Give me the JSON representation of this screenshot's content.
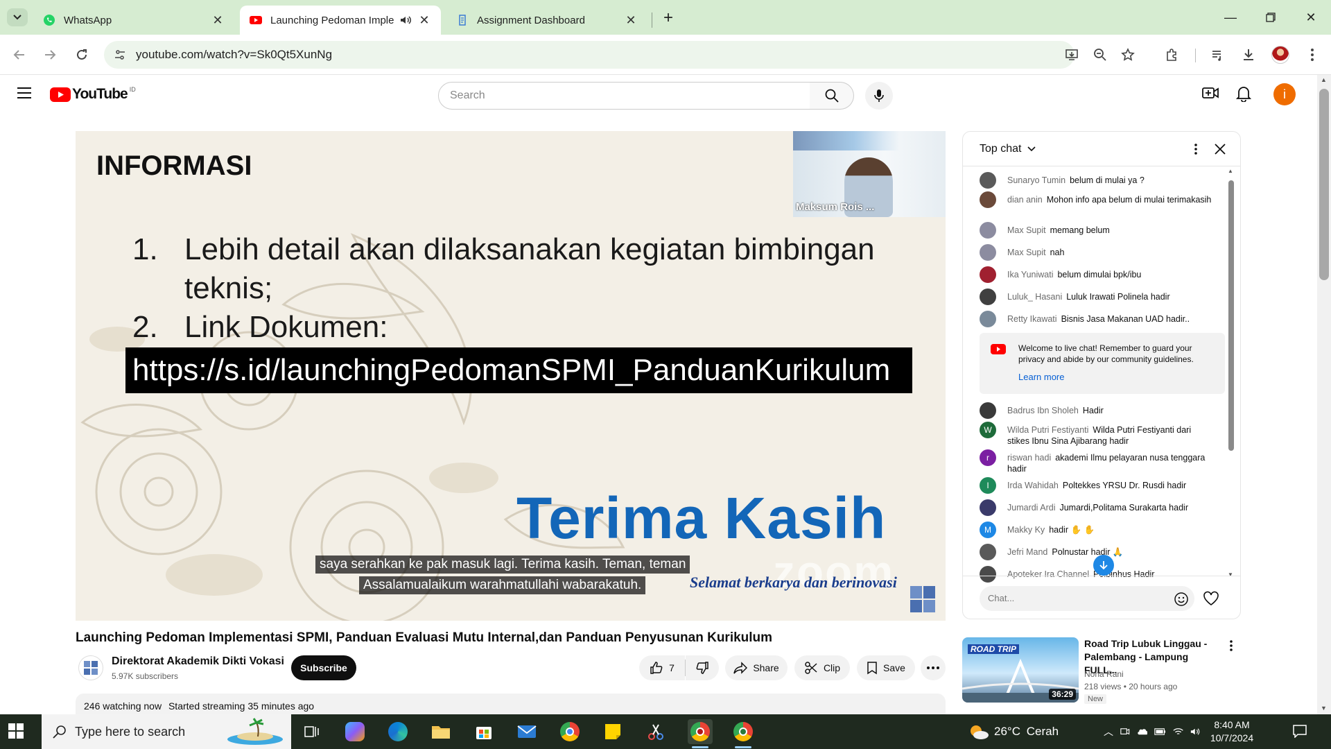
{
  "tabs": [
    {
      "label": "WhatsApp",
      "icon": "whatsapp-icon"
    },
    {
      "label": "Launching Pedoman Implem",
      "icon": "youtube-icon",
      "active": true
    },
    {
      "label": "Assignment Dashboard",
      "icon": "assignment-icon"
    }
  ],
  "address": {
    "url": "youtube.com/watch?v=Sk0Qt5XunNg"
  },
  "youtube": {
    "logo_text": "YouTube",
    "region": "ID",
    "search_placeholder": "Search",
    "avatar_letter": "i"
  },
  "video": {
    "slide_heading": "INFORMASI",
    "item1_num": "1.",
    "item1_text": "Lebih detail akan dilaksanakan kegiatan bimbingan",
    "item1_cont": "teknis;",
    "item2_num": "2.",
    "item2_text": "Link Dokumen:",
    "link": "https://s.id/launchingPedomanSPMI_PanduanKurikulum",
    "thanks": "Terima Kasih",
    "tagline": "Selamat berkarya dan berinovasi",
    "watermark": "zoom",
    "caption1": "saya serahkan ke pak masuk lagi. Terima kasih. Teman, teman",
    "caption2": "Assalamualaikum warahmatullahi wabarakatuh.",
    "pip_name": "Maksum Rois ...",
    "title": "Launching Pedoman Implementasi SPMI, Panduan Evaluasi Mutu Internal,dan Panduan Penyusunan Kurikulum"
  },
  "channel": {
    "name": "Direktorat Akademik Dikti Vokasi",
    "subscribers": "5.97K subscribers",
    "subscribe_label": "Subscribe"
  },
  "actions": {
    "likes": "7",
    "share": "Share",
    "clip": "Clip",
    "save": "Save"
  },
  "description": {
    "watching": "246 watching now",
    "started": "Started streaming 35 minutes ago"
  },
  "chat": {
    "title": "Top chat",
    "messages_top": [
      {
        "author": "Sunaryo Tumin",
        "text": "belum di mulai ya ?",
        "color": "#5a5a5a"
      },
      {
        "author": "dian anin",
        "text": "Mohon info apa belum di mulai terimakasih",
        "color": "#6b4a3a"
      },
      {
        "author": "Max Supit",
        "text": "memang belum",
        "color": "#8c8ca0"
      },
      {
        "author": "Max Supit",
        "text": "nah",
        "color": "#8c8ca0"
      },
      {
        "author": "Ika Yuniwati",
        "text": "belum dimulai bpk/ibu",
        "color": "#a02030"
      },
      {
        "author": "Luluk_ Hasani",
        "text": "Luluk Irawati Polinela hadir",
        "color": "#404040"
      },
      {
        "author": "Retty Ikawati",
        "text": "Bisnis Jasa Makanan UAD hadir..",
        "color": "#7a8a9a"
      }
    ],
    "welcome_text": "Welcome to live chat! Remember to guard your privacy and abide by our community guidelines.",
    "learn_more": "Learn more",
    "messages_bottom": [
      {
        "author": "Badrus Ibn Sholeh",
        "text": "Hadir",
        "color": "#3a3a3a",
        "letter": ""
      },
      {
        "author": "Wilda Putri Festiyanti",
        "text": "Wilda Putri Festiyanti dari stikes Ibnu Sina Ajibarang hadir",
        "color": "#1e6b3a",
        "letter": "W"
      },
      {
        "author": "riswan hadi",
        "text": "akademi Ilmu pelayaran nusa tenggara hadir",
        "color": "#7b1fa2",
        "letter": "r"
      },
      {
        "author": "Irda Wahidah",
        "text": "Poltekkes YRSU Dr. Rusdi hadir",
        "color": "#1e8a5a",
        "letter": "I"
      },
      {
        "author": "Jumardi Ardi",
        "text": "Jumardi,Politama Surakarta hadir",
        "color": "#3a3a6a",
        "letter": ""
      },
      {
        "author": "Makky Ky",
        "text": "hadir ✋ ✋",
        "color": "#1e88e5",
        "letter": "M"
      },
      {
        "author": "Jefri Mand",
        "text": "Polnustar hadir 🙏",
        "color": "#5a5a5a",
        "letter": ""
      },
      {
        "author": "Apoteker Ira Channel",
        "text": "Polbinhus Hadir",
        "color": "#4a4a4a",
        "letter": ""
      }
    ],
    "input_placeholder": "Chat..."
  },
  "related": {
    "title": "Road Trip Lubuk Linggau - Palembang - Lampung FULL...",
    "channel": "Nona Rani",
    "views": "218 views",
    "age": "20 hours ago",
    "badge": "New",
    "duration": "36:29",
    "thumb_text": "ROAD TRIP"
  },
  "taskbar": {
    "search_placeholder": "Type here to search",
    "temperature": "26°C",
    "weather": "Cerah",
    "time": "8:40 AM",
    "date": "10/7/2024"
  },
  "colors": {
    "tabbar": "#d6ecd1",
    "youtube_red": "#ff0000",
    "accent": "#1366b8",
    "avatar": "#ef6c00"
  }
}
